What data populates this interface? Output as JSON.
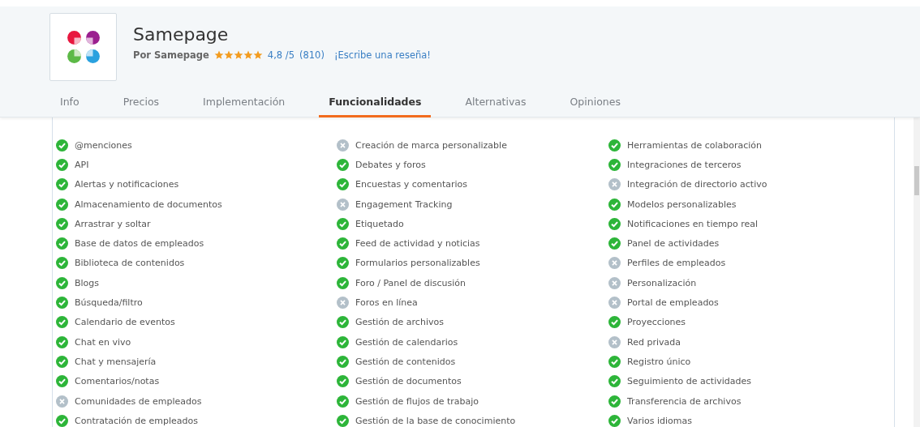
{
  "product": {
    "name": "Samepage",
    "vendor": "Por Samepage",
    "stars": 5,
    "rating": "4,8 /5",
    "reviews": "(810)",
    "review_link": "¡Escribe una reseña!"
  },
  "tabs": [
    {
      "label": "Info",
      "selected": false
    },
    {
      "label": "Precios",
      "selected": false
    },
    {
      "label": "Implementación",
      "selected": false
    },
    {
      "label": "Funcionalidades",
      "selected": true
    },
    {
      "label": "Alternativas",
      "selected": false
    },
    {
      "label": "Opiniones",
      "selected": false
    }
  ],
  "feature_columns": [
    [
      {
        "label": "@menciones",
        "available": true
      },
      {
        "label": "API",
        "available": true
      },
      {
        "label": "Alertas y notificaciones",
        "available": true
      },
      {
        "label": "Almacenamiento de documentos",
        "available": true
      },
      {
        "label": "Arrastrar y soltar",
        "available": true
      },
      {
        "label": "Base de datos de empleados",
        "available": true
      },
      {
        "label": "Biblioteca de contenidos",
        "available": true
      },
      {
        "label": "Blogs",
        "available": true
      },
      {
        "label": "Búsqueda/filtro",
        "available": true
      },
      {
        "label": "Calendario de eventos",
        "available": true
      },
      {
        "label": "Chat en vivo",
        "available": true
      },
      {
        "label": "Chat y mensajería",
        "available": true
      },
      {
        "label": "Comentarios/notas",
        "available": true
      },
      {
        "label": "Comunidades de empleados",
        "available": false
      },
      {
        "label": "Contratación de empleados",
        "available": true
      }
    ],
    [
      {
        "label": "Creación de marca personalizable",
        "available": false
      },
      {
        "label": "Debates y foros",
        "available": true
      },
      {
        "label": "Encuestas y comentarios",
        "available": true
      },
      {
        "label": "Engagement Tracking",
        "available": false
      },
      {
        "label": "Etiquetado",
        "available": true
      },
      {
        "label": "Feed de actividad y noticias",
        "available": true
      },
      {
        "label": "Formularios personalizables",
        "available": true
      },
      {
        "label": "Foro / Panel de discusión",
        "available": true
      },
      {
        "label": "Foros en línea",
        "available": false
      },
      {
        "label": "Gestión de archivos",
        "available": true
      },
      {
        "label": "Gestión de calendarios",
        "available": true
      },
      {
        "label": "Gestión de contenidos",
        "available": true
      },
      {
        "label": "Gestión de documentos",
        "available": true
      },
      {
        "label": "Gestión de flujos de trabajo",
        "available": true
      },
      {
        "label": "Gestión de la base de conocimiento",
        "available": true
      }
    ],
    [
      {
        "label": "Herramientas de colaboración",
        "available": true
      },
      {
        "label": "Integraciones de terceros",
        "available": true
      },
      {
        "label": "Integración de directorio activo",
        "available": false
      },
      {
        "label": "Modelos personalizables",
        "available": true
      },
      {
        "label": "Notificaciones en tiempo real",
        "available": true
      },
      {
        "label": "Panel de actividades",
        "available": true
      },
      {
        "label": "Perfiles de empleados",
        "available": false
      },
      {
        "label": "Personalización",
        "available": false
      },
      {
        "label": "Portal de empleados",
        "available": false
      },
      {
        "label": "Proyecciones",
        "available": true
      },
      {
        "label": "Red privada",
        "available": false
      },
      {
        "label": "Registro único",
        "available": true
      },
      {
        "label": "Seguimiento de actividades",
        "available": true
      },
      {
        "label": "Transferencia de archivos",
        "available": true
      },
      {
        "label": "Varios idiomas",
        "available": true
      }
    ]
  ]
}
